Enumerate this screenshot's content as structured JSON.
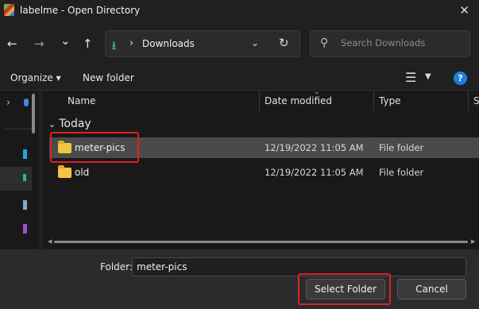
{
  "window": {
    "title": "labelme - Open Directory",
    "close_glyph": "✕"
  },
  "nav": {
    "back_glyph": "←",
    "forward_glyph": "→",
    "recent_glyph": "⌄",
    "up_glyph": "↑",
    "address": {
      "icon": "download-icon",
      "separator": "›",
      "path": "Downloads",
      "dropdown_glyph": "⌄",
      "refresh_glyph": "↻"
    },
    "search": {
      "placeholder": "Search Downloads",
      "value": ""
    }
  },
  "toolbar": {
    "organize_label": "Organize ▾",
    "new_folder_label": "New folder",
    "view_glyph": "☰",
    "view_dd_glyph": "▼",
    "help_glyph": "?"
  },
  "navpane": {
    "expand_glyph": "›"
  },
  "list": {
    "columns": [
      "Name",
      "Date modified",
      "Type",
      "S"
    ],
    "group_label": "Today",
    "group_caret": "⌄",
    "rows": [
      {
        "name": "meter-pics",
        "date": "12/19/2022 11:05 AM",
        "type": "File folder",
        "selected": true
      },
      {
        "name": "old",
        "date": "12/19/2022 11:05 AM",
        "type": "File folder",
        "selected": false
      }
    ]
  },
  "footer": {
    "folder_label": "Folder:",
    "folder_value": "meter-pics",
    "select_button": "Select Folder",
    "cancel_button": "Cancel"
  },
  "colors": {
    "accent": "#1e7fd6",
    "highlight_box": "#e02020",
    "folder": "#f0c542"
  }
}
